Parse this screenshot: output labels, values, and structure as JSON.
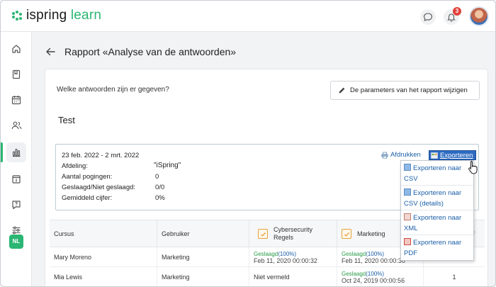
{
  "brand": {
    "part1": "ispring",
    "part2": "learn",
    "accent": "#2bb673"
  },
  "header": {
    "notifications_count": "3"
  },
  "sidebar": {
    "items": [
      {
        "icon": "home-icon"
      },
      {
        "icon": "book-icon"
      },
      {
        "icon": "calendar-icon"
      },
      {
        "icon": "users-icon"
      },
      {
        "icon": "reports-icon",
        "active": true
      },
      {
        "icon": "info-icon"
      },
      {
        "icon": "help-icon"
      },
      {
        "icon": "settings-icon"
      }
    ],
    "language": "NL"
  },
  "page": {
    "title": "Rapport «Analyse van de antwoorden»"
  },
  "card": {
    "question": "Welke antwoorden zijn er gegeven?",
    "params_button": "De parameters van het rapport wijzigen",
    "subtitle": "Test"
  },
  "info": {
    "date_range": "23 feb. 2022 - 2 mrt. 2022",
    "rows": [
      {
        "label": "Afdeling:",
        "value": "\"iSpring\""
      },
      {
        "label": "Aantal pogingen:",
        "value": "0"
      },
      {
        "label": "Geslaagd/Niet geslaagd:",
        "value": "0/0"
      },
      {
        "label": "Gemiddeld cijfer:",
        "value": "0%"
      }
    ],
    "print_label": "Afdrukken",
    "export_label": "Exporteren"
  },
  "export_menu": [
    "Exporteren naar CSV",
    "Exporteren naar CSV (details)",
    "Exporteren naar XML",
    "Exporteren naar PDF"
  ],
  "table": {
    "columns": [
      "Cursus",
      "Gebruiker",
      "Cybersecurity Regels",
      "Marketing"
    ],
    "rows": [
      {
        "course": "Mary Moreno",
        "user": "Marketing",
        "cyber_status": "Geslaagd",
        "cyber_pct": "(100%)",
        "cyber_date": "Feb 11, 2020 00:00:32",
        "mkt_status": "Geslaagd",
        "mkt_pct": "(100%)",
        "mkt_date": "Feb 11, 2020 00:00:30",
        "extra": ""
      },
      {
        "course": "Mia Lewis",
        "user": "Marketing",
        "cyber_text": "Niet vermeld",
        "mkt_status": "Geslaagd",
        "mkt_pct": "(100%)",
        "mkt_date": "Oct 24, 2019 00:00:56",
        "extra": "1"
      }
    ]
  }
}
